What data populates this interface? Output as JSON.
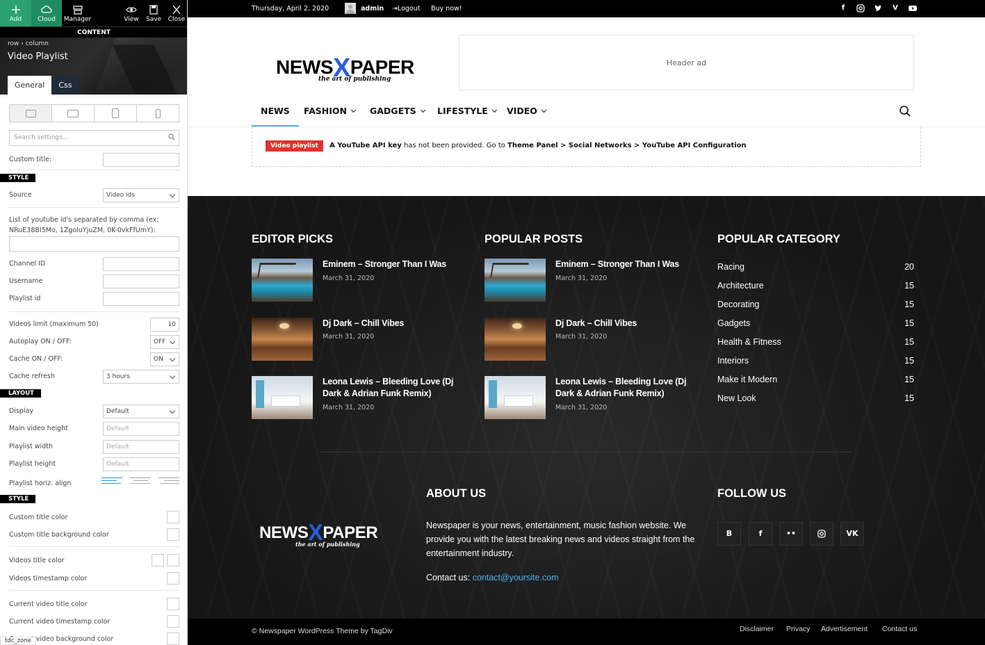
{
  "toolbar": {
    "add_label": "Add",
    "cloud_label": "Cloud",
    "manager_label": "Manager",
    "view_label": "View",
    "save_label": "Save",
    "close_label": "Close",
    "content_label": "CONTENT"
  },
  "panel": {
    "breadcrumb_row": "row",
    "breadcrumb_sep": "›",
    "breadcrumb_column": "column",
    "title": "Video Playlist",
    "tabs": [
      "General",
      "Css"
    ],
    "search_placeholder": "Search settings...",
    "custom_title_label": "Custom title:",
    "section_style": "STYLE",
    "source_label": "Source",
    "source_value": "Video ids",
    "yt_ids_label": "List of youtube id's separated by comma (ex: NRuE38BI5Mo, 1ZgoluYjuZM, 0K-0vkFfUmY):",
    "channel_id_label": "Channel ID",
    "username_label": "Username",
    "playlist_id_label": "Playlist id",
    "videos_limit_label": "Videos limit (maximum 50)",
    "videos_limit_value": "10",
    "autoplay_label": "Autoplay ON / OFF:",
    "autoplay_value": "OFF",
    "cache_label": "Cache ON / OFF:",
    "cache_value": "ON",
    "cache_refresh_label": "Cache refresh",
    "cache_refresh_value": "3 hours",
    "section_layout": "LAYOUT",
    "display_label": "Display",
    "display_value": "Default",
    "main_video_height_label": "Main video height",
    "playlist_width_label": "Playlist width",
    "playlist_height_label": "Playlist height",
    "default_placeholder": "Default",
    "playlist_align_label": "Playlist horiz. align",
    "section_style2": "STYLE",
    "custom_title_color_label": "Custom title color",
    "custom_title_bg_label": "Custom title background color",
    "videos_title_color_label": "Videos title color",
    "videos_timestamp_color_label": "Videos timestamp color",
    "current_video_title_color_label": "Current video title color",
    "current_video_timestamp_label": "Current video timestamp color",
    "current_video_bg_label": "Current video background color",
    "tdc_zone": "tdc_zone"
  },
  "topbar": {
    "date": "Thursday, April 2, 2020",
    "user": "admin",
    "logout": "Logout",
    "buy": "Buy now!"
  },
  "header": {
    "logo_left": "NEWS",
    "logo_x": "X",
    "logo_right": "PAPER",
    "tagline": "the art of publishing",
    "ad_text": "Header ad"
  },
  "menu": {
    "items": [
      "NEWS",
      "FASHION",
      "GADGETS",
      "LIFESTYLE",
      "VIDEO"
    ]
  },
  "notice": {
    "badge": "Video playlist",
    "part1": "A YouTube API key",
    "part2": " has not been provided. Go to ",
    "part3": "Theme Panel > Social Networks > YouTube API Configuration"
  },
  "footer": {
    "editor_picks_title": "EDITOR PICKS",
    "popular_posts_title": "POPULAR POSTS",
    "popular_category_title": "POPULAR CATEGORY",
    "posts": [
      {
        "title": "Eminem – Stronger Than I Was",
        "date": "March 31, 2020"
      },
      {
        "title": "Dj Dark – Chill Vibes",
        "date": "March 31, 2020"
      },
      {
        "title": "Leona Lewis – Bleeding Love (Dj Dark & Adrian Funk Remix)",
        "date": "March 31, 2020"
      }
    ],
    "categories": [
      {
        "name": "Racing",
        "count": "20"
      },
      {
        "name": "Architecture",
        "count": "15"
      },
      {
        "name": "Decorating",
        "count": "15"
      },
      {
        "name": "Gadgets",
        "count": "15"
      },
      {
        "name": "Health & Fitness",
        "count": "15"
      },
      {
        "name": "Interiors",
        "count": "15"
      },
      {
        "name": "Make it Modern",
        "count": "15"
      },
      {
        "name": "New Look",
        "count": "15"
      }
    ],
    "about_title": "ABOUT US",
    "about_text": "Newspaper is your news, entertainment, music fashion website. We provide you with the latest breaking news and videos straight from the entertainment industry.",
    "contact_label": "Contact us: ",
    "contact_email": "contact@yoursite.com",
    "follow_title": "FOLLOW US",
    "copyright": "© Newspaper WordPress Theme by TagDiv",
    "links": [
      "Disclaimer",
      "Privacy",
      "Advertisement",
      "Contact us"
    ]
  },
  "colors": {
    "accent": "#4db2ec",
    "logo_x": "#2d5be3",
    "badge": "#e0332f",
    "add_button": "#2ba16f"
  }
}
